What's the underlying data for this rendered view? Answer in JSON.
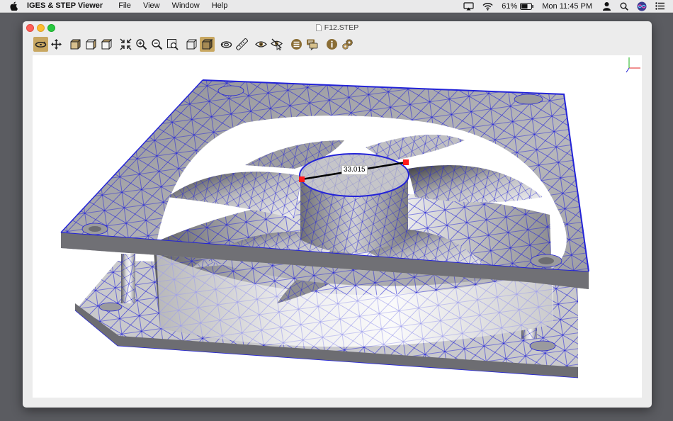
{
  "menubar": {
    "app_name": "IGES & STEP Viewer",
    "menus": [
      "File",
      "View",
      "Window",
      "Help"
    ],
    "battery_percent": "61%",
    "clock": "Mon 11:45 PM"
  },
  "window": {
    "title": "F12.STEP"
  },
  "toolbar": {
    "buttons": [
      {
        "icon": "rotate-icon",
        "active": true
      },
      {
        "icon": "pan-icon",
        "active": false
      },
      {
        "icon": "front-view-icon",
        "active": false
      },
      {
        "icon": "side-view-icon",
        "active": false
      },
      {
        "icon": "iso-view-icon",
        "active": false
      },
      {
        "icon": "fit-all-icon",
        "active": false
      },
      {
        "icon": "zoom-in-icon",
        "active": false
      },
      {
        "icon": "zoom-out-icon",
        "active": false
      },
      {
        "icon": "zoom-window-icon",
        "active": false
      },
      {
        "icon": "wireframe-cube-icon",
        "active": false
      },
      {
        "icon": "shaded-cube-icon",
        "active": true
      },
      {
        "icon": "rotate-model-icon",
        "active": false
      },
      {
        "icon": "measure-ruler-icon",
        "active": false
      },
      {
        "icon": "show-eye-icon",
        "active": false
      },
      {
        "icon": "hide-eye-icon",
        "active": false
      },
      {
        "icon": "list-icon",
        "active": false
      },
      {
        "icon": "comments-icon",
        "active": false
      },
      {
        "icon": "info-icon",
        "active": false
      },
      {
        "icon": "settings-gears-icon",
        "active": false
      }
    ]
  },
  "viewport": {
    "model": "fan",
    "measurement": "33.015",
    "colors": {
      "mesh": "#2323d8",
      "surface": "#a4a4a8",
      "marker": "#ff1a1a"
    }
  }
}
